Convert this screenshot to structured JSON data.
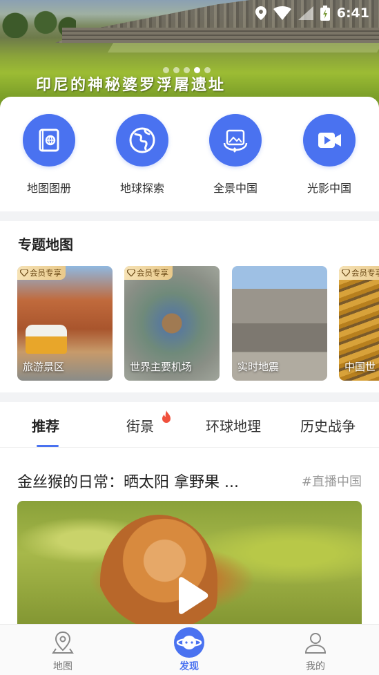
{
  "status_bar": {
    "time": "6:41"
  },
  "banner": {
    "caption": "印尼的神秘婆罗浮屠遗址",
    "dots_count": 5,
    "active_dot": 4
  },
  "quick_entries": [
    {
      "label": "地图图册",
      "icon": "map-atlas-icon"
    },
    {
      "label": "地球探索",
      "icon": "globe-icon"
    },
    {
      "label": "全景中国",
      "icon": "panorama-icon"
    },
    {
      "label": "光影中国",
      "icon": "video-camera-icon"
    }
  ],
  "special_maps": {
    "title": "专题地图",
    "cards": [
      {
        "label": "旅游景区",
        "vip": "会员专享"
      },
      {
        "label": "世界主要机场",
        "vip": "会员专享"
      },
      {
        "label": "实时地震",
        "vip": ""
      },
      {
        "label": "中国世",
        "vip": "会员专享"
      }
    ]
  },
  "tabs": [
    {
      "label": "推荐",
      "active": true
    },
    {
      "label": "街景",
      "hot": true
    },
    {
      "label": "环球地理"
    },
    {
      "label": "历史战争"
    }
  ],
  "article": {
    "title": "金丝猴的日常：晒太阳 拿野果 ...",
    "tag": "#直播中国"
  },
  "bottom_nav": [
    {
      "label": "地图",
      "icon": "map-pin-icon"
    },
    {
      "label": "发现",
      "icon": "discover-icon",
      "active": true
    },
    {
      "label": "我的",
      "icon": "user-icon"
    }
  ],
  "colors": {
    "accent": "#4a72f0",
    "vip_gold": "#e9c98a",
    "hot": "#f0503c"
  }
}
